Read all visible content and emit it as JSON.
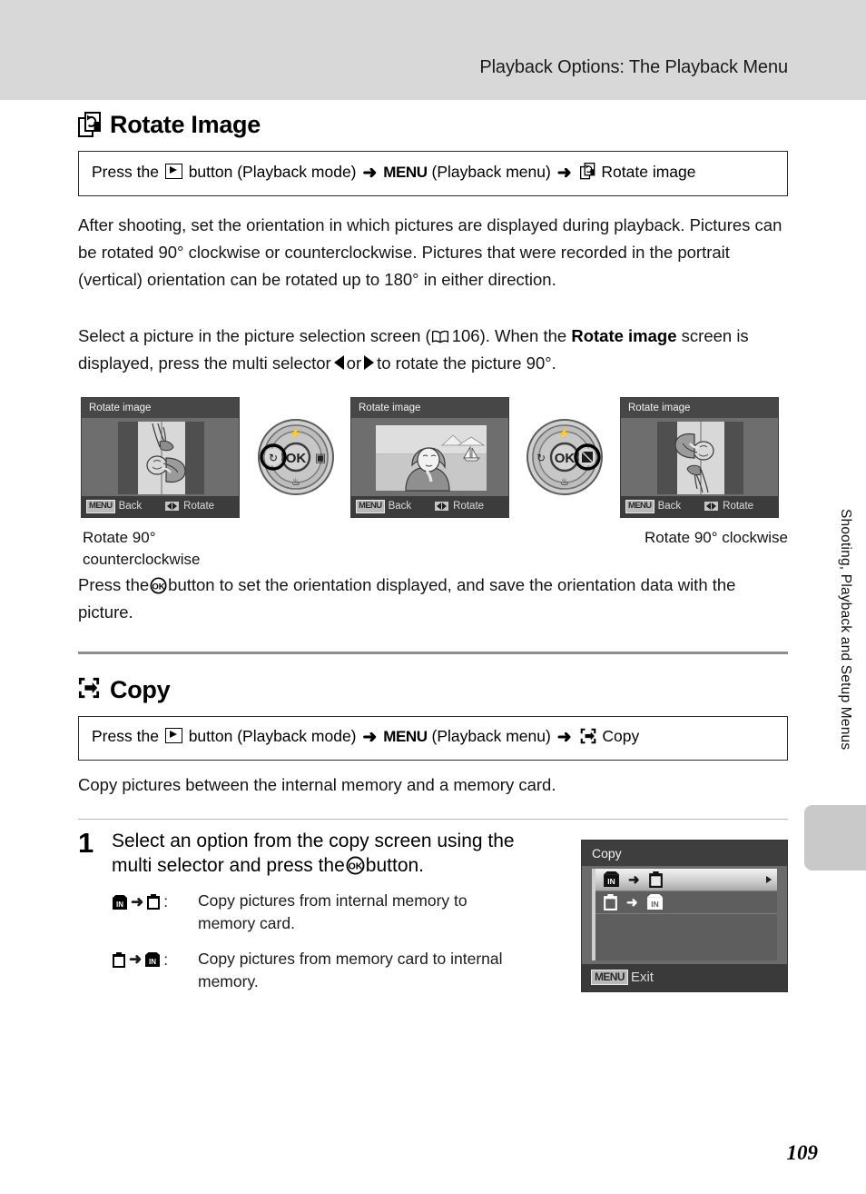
{
  "header": {
    "running_title": "Playback Options: The Playback Menu"
  },
  "sections": {
    "rotate": {
      "heading": "Rotate Image",
      "heading_icon": "rotate-image-icon",
      "press_path": {
        "prefix": "Press the",
        "playback_icon": "playback-button-icon",
        "mid1": "button (Playback mode)",
        "arrow": "➜",
        "menu_word": "MENU",
        "mid2": "(Playback menu)",
        "target_icon": "rotate-image-icon",
        "target": "Rotate image"
      },
      "intro": "After shooting, set the orientation in which pictures are displayed during playback. Pictures can be rotated 90° clockwise or counterclockwise. Pictures that were recorded in the portrait (vertical) orientation can be rotated up to 180° in either direction.",
      "select_text_1": "Select a picture in the picture selection screen (",
      "select_page_ref": "106",
      "select_text_2": "). When the ",
      "select_bold": "Rotate image",
      "select_text_3": "screen is displayed, press the multi selector",
      "select_or": "or",
      "select_text_4": "to rotate the picture 90°.",
      "screens": [
        {
          "title": "Rotate image",
          "menu_chip": "MENU",
          "back_label": "Back",
          "rotate_label": "Rotate",
          "orientation": "portrait-ccw"
        },
        {
          "title": "Rotate image",
          "menu_chip": "MENU",
          "back_label": "Back",
          "rotate_label": "Rotate",
          "orientation": "landscape"
        },
        {
          "title": "Rotate image",
          "menu_chip": "MENU",
          "back_label": "Back",
          "rotate_label": "Rotate",
          "orientation": "portrait-cw"
        }
      ],
      "caption_left": "Rotate 90° counterclockwise",
      "caption_right": "Rotate 90° clockwise",
      "press_ok_1": "Press the",
      "press_ok_2": "button to set the orientation displayed, and save the orientation data with the picture."
    },
    "copy": {
      "heading": "Copy",
      "heading_icon": "copy-icon",
      "press_path": {
        "prefix": "Press the",
        "playback_icon": "playback-button-icon",
        "mid1": "button (Playback mode)",
        "arrow": "➜",
        "menu_word": "MENU",
        "mid2": "(Playback menu)",
        "target_icon": "copy-icon",
        "target": "Copy"
      },
      "description": "Copy pictures between the internal memory and a memory card.",
      "step": {
        "number": "1",
        "title_1": "Select an option from the copy screen using the multi selector and press the",
        "title_2": "button.",
        "options": [
          {
            "from_icon": "internal-memory-icon",
            "to_icon": "memory-card-icon",
            "colon": ":",
            "description": "Copy pictures from internal memory to memory card."
          },
          {
            "from_icon": "memory-card-icon",
            "to_icon": "internal-memory-icon",
            "colon": ":",
            "description": "Copy pictures from memory card to internal memory."
          }
        ]
      },
      "lcd": {
        "title": "Copy",
        "items": [
          {
            "from_icon": "internal-memory-icon",
            "to_icon": "memory-card-icon",
            "selected": true
          },
          {
            "from_icon": "memory-card-icon",
            "to_icon": "internal-memory-icon",
            "selected": false
          }
        ],
        "menu_chip": "MENU",
        "exit_label": "Exit"
      }
    }
  },
  "side": {
    "vertical_label": "Shooting, Playback and Setup Menus"
  },
  "footer": {
    "page_number": "109"
  },
  "colors": {
    "header_band": "#d8d8d8",
    "divider": "#8f8f8f",
    "lcd_bg": "#6e6e6e",
    "lcd_title_bg": "#474747",
    "side_tab": "#c9c9c9"
  }
}
